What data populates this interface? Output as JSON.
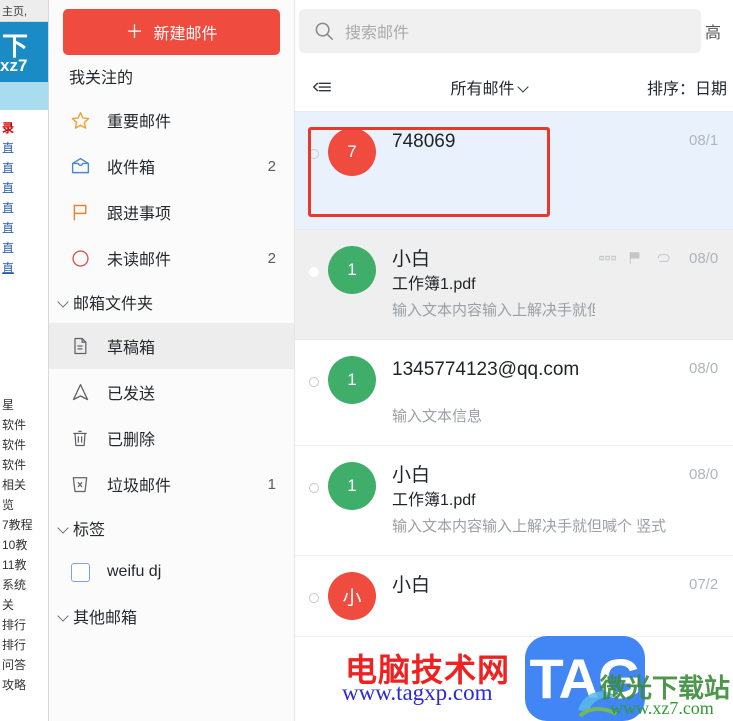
{
  "background_page": {
    "topbar_text": "主页,",
    "banner_big": "下",
    "banner_small": "xz7",
    "links_top": [
      "录",
      "直",
      "直",
      "直",
      "直",
      "直",
      "直",
      "直"
    ],
    "links_bottom": [
      "星",
      "软件",
      "软件",
      "软件",
      "相关",
      "览",
      "7教程",
      "10教",
      "11教",
      "系统",
      "关",
      "排行",
      "排行",
      "问答",
      "攻略"
    ]
  },
  "sidebar": {
    "compose": {
      "icon": "plus-icon",
      "label": "新建邮件",
      "color": "#ef4b3f"
    },
    "favorites_section": {
      "label": "我关注的"
    },
    "favorites": [
      {
        "icon": "star-icon",
        "label": "重要邮件",
        "count": ""
      },
      {
        "icon": "inbox-icon",
        "label": "收件箱",
        "count": "2"
      },
      {
        "icon": "flag-icon",
        "label": "跟进事项",
        "count": ""
      },
      {
        "icon": "circle-icon",
        "label": "未读邮件",
        "count": "2"
      }
    ],
    "folders_section": {
      "label": "邮箱文件夹",
      "icon": "chevron-down-icon"
    },
    "folders": [
      {
        "icon": "document-icon",
        "label": "草稿箱",
        "count": "",
        "active": true
      },
      {
        "icon": "send-icon",
        "label": "已发送",
        "count": "",
        "active": false
      },
      {
        "icon": "trash-icon",
        "label": "已删除",
        "count": "",
        "active": false
      },
      {
        "icon": "junk-icon",
        "label": "垃圾邮件",
        "count": "1",
        "active": false
      }
    ],
    "tags_section": {
      "label": "标签",
      "icon": "chevron-down-icon"
    },
    "tags": [
      {
        "icon": "tag-box-icon",
        "label": "weifu dj"
      }
    ],
    "other_section": {
      "label": "其他邮箱",
      "icon": "chevron-down-icon"
    }
  },
  "search": {
    "icon": "search-icon",
    "placeholder": "搜索邮件",
    "value": "",
    "tail_text": "高"
  },
  "toolbar": {
    "collapse_icon": "collapse-list-icon",
    "filter_label": "所有邮件",
    "filter_chevron": "chevron-down-icon",
    "sort_label": "排序：日期"
  },
  "mail_list": [
    {
      "avatar_text": "7",
      "avatar_color": "#ef4b3f",
      "sender": "748069",
      "subject": "",
      "preview": "",
      "date": "08/1",
      "state": "selected",
      "read_dot": "hollow",
      "hover_icons": []
    },
    {
      "avatar_text": "1",
      "avatar_color": "#3fae6a",
      "sender": "小白",
      "subject": "工作簿1.pdf",
      "preview": "输入文本内容输入上解决手就但喊个 竖式",
      "date": "08/0",
      "state": "hovered",
      "read_dot": "filled",
      "hover_icons": [
        "more-icon",
        "flag-icon",
        "attachment-icon"
      ]
    },
    {
      "avatar_text": "1",
      "avatar_color": "#3fae6a",
      "sender": "1345774123@qq.com",
      "subject": "",
      "preview": "输入文本信息",
      "date": "08/0",
      "state": "normal",
      "read_dot": "hollow",
      "hover_icons": []
    },
    {
      "avatar_text": "1",
      "avatar_color": "#3fae6a",
      "sender": "小白",
      "subject": "工作簿1.pdf",
      "preview": "输入文本内容输入上解决手就但喊个 竖式",
      "date": "08/0",
      "state": "normal",
      "read_dot": "hollow",
      "hover_icons": []
    },
    {
      "avatar_text": "小",
      "avatar_color": "#ef4b3f",
      "sender": "小白",
      "subject": "",
      "preview": "",
      "date": "07/2",
      "state": "normal",
      "read_dot": "hollow",
      "hover_icons": []
    }
  ],
  "annotation": {
    "shape": "rectangle",
    "color": "#e8392a"
  },
  "watermarks": {
    "site_cn": "电脑技术网",
    "site_url": "www.tagxp.com",
    "tag_logo": "TAG",
    "xz_cn": "微光下载站",
    "xz_url": "www.xz7.com"
  }
}
